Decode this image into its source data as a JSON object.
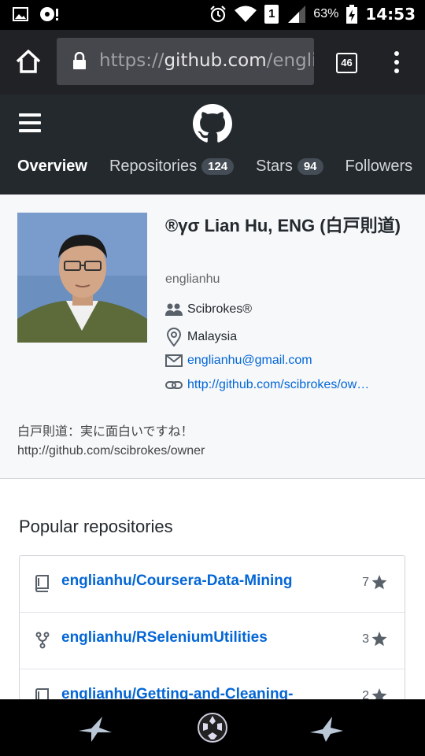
{
  "status_bar": {
    "battery_percent": "63%",
    "time": "14:53",
    "sim_label": "1"
  },
  "browser": {
    "url_prefix": "https://",
    "url_host": "github.com",
    "url_rest": "/engli",
    "tab_count": "46"
  },
  "github_nav": {
    "tabs": [
      {
        "label": "Overview",
        "count": null,
        "active": true
      },
      {
        "label": "Repositories",
        "count": "124",
        "active": false
      },
      {
        "label": "Stars",
        "count": "94",
        "active": false
      },
      {
        "label": "Followers",
        "count": null,
        "active": false
      }
    ]
  },
  "profile": {
    "full_name": "®γσ Lian Hu, ENG (白戸則道)",
    "username": "englianhu",
    "organization": "Scibrokes®",
    "location": "Malaysia",
    "email": "englianhu@gmail.com",
    "website": "http://github.com/scibrokes/ow…",
    "bio_line1": "白戸則道：実に面白いですね！",
    "bio_line2": "http://github.com/scibrokes/owner"
  },
  "popular": {
    "title": "Popular repositories",
    "repos": [
      {
        "name": "englianhu/Coursera-Data-Mining",
        "stars": "7",
        "icon": "repo-icon"
      },
      {
        "name": "englianhu/RSeleniumUtilities",
        "stars": "3",
        "icon": "fork-icon"
      },
      {
        "name": "englianhu/Getting-and-Cleaning-",
        "stars": "2",
        "icon": "repo-icon"
      }
    ]
  },
  "colors": {
    "github_header": "#24292e",
    "link_blue": "#0366d6",
    "profile_bg": "#f6f8fa"
  }
}
